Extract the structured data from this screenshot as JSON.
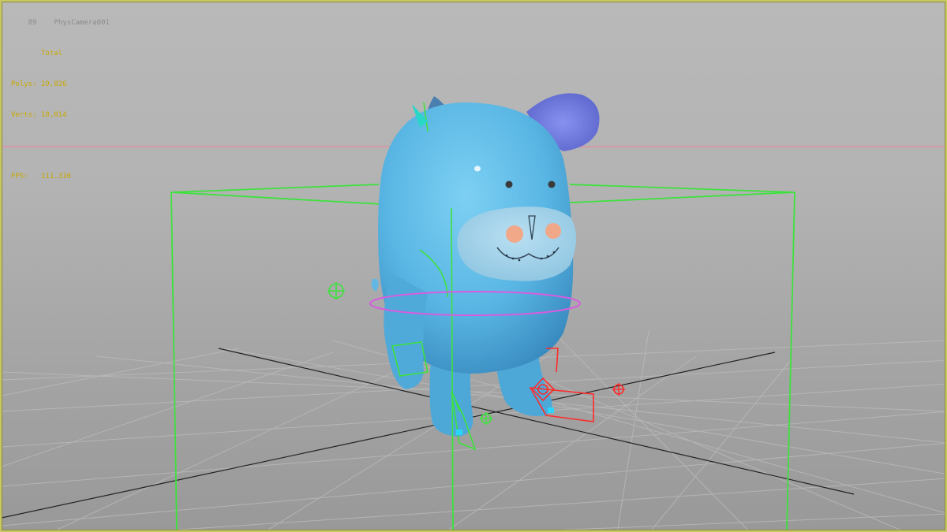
{
  "viewport": {
    "frame": "89",
    "camera_name": "PhysCamera001",
    "accent_color": "#c8c864"
  },
  "stats": {
    "header": "Total",
    "rows": [
      {
        "label": "Polys:",
        "value": "19,826"
      },
      {
        "label": "Verts:",
        "value": "10,014"
      }
    ],
    "fps_label": "FPS:",
    "fps_value": "111.310",
    "text_color": "#c8a800"
  },
  "scene": {
    "character_color": "#5ab8e6",
    "ear_color": "#7b86e6",
    "bounding_box_color": "#3de23d",
    "rig_left_color": "#3de23d",
    "rig_right_color": "#ff2a2a",
    "waist_ring_color": "#d85ce0",
    "horizon_line_color": "#e88aa0",
    "grid_color": "#bdbdbd"
  }
}
